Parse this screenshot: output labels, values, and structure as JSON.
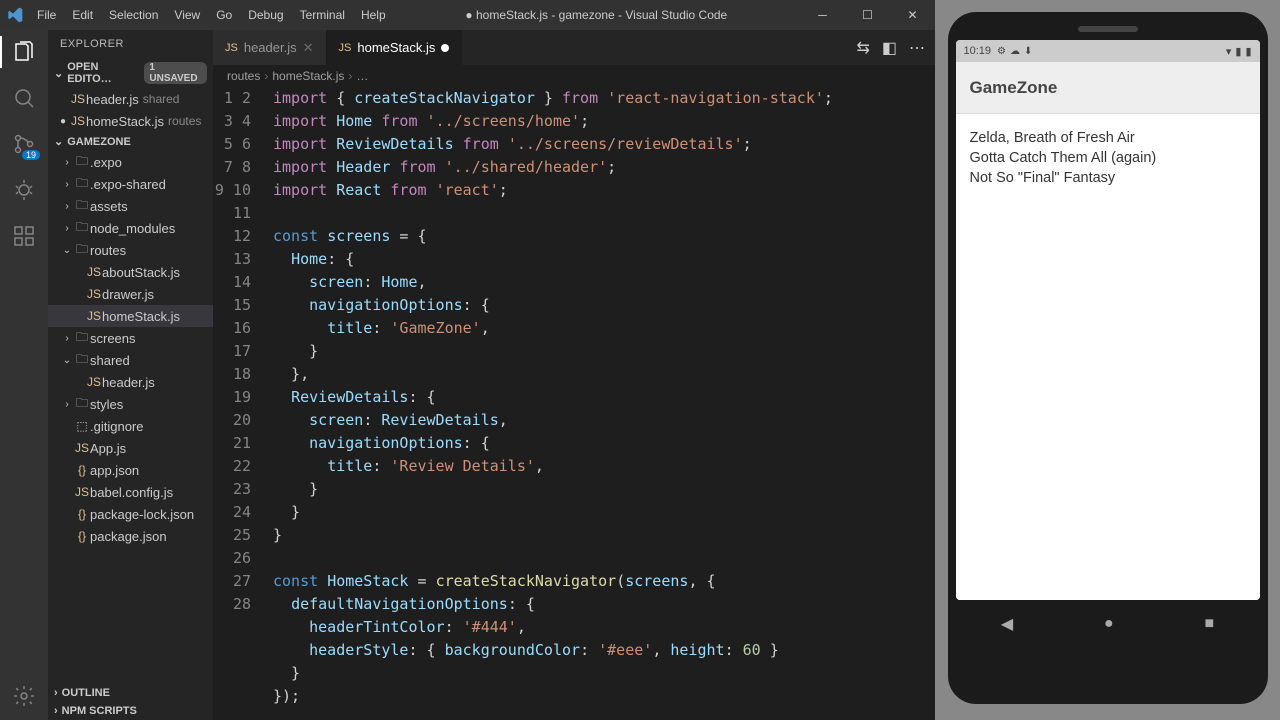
{
  "window": {
    "title": "● homeStack.js - gamezone - Visual Studio Code"
  },
  "menu": [
    "File",
    "Edit",
    "Selection",
    "View",
    "Go",
    "Debug",
    "Terminal",
    "Help"
  ],
  "activity": {
    "scm_badge": "19"
  },
  "explorer": {
    "title": "EXPLORER",
    "open_editors": "OPEN EDITO…",
    "unsaved": "1 UNSAVED",
    "open_items": [
      {
        "name": "header.js",
        "hint": "shared"
      },
      {
        "name": "homeStack.js",
        "hint": "routes",
        "dirty": true
      }
    ],
    "project": "GAMEZONE",
    "tree": [
      {
        "d": 1,
        "t": "folder",
        "tw": "›",
        "name": ".expo"
      },
      {
        "d": 1,
        "t": "folder",
        "tw": "›",
        "name": ".expo-shared"
      },
      {
        "d": 1,
        "t": "folder",
        "tw": "›",
        "name": "assets"
      },
      {
        "d": 1,
        "t": "folder",
        "tw": "›",
        "name": "node_modules"
      },
      {
        "d": 1,
        "t": "folder",
        "tw": "⌄",
        "name": "routes"
      },
      {
        "d": 2,
        "t": "js",
        "name": "aboutStack.js"
      },
      {
        "d": 2,
        "t": "js",
        "name": "drawer.js"
      },
      {
        "d": 2,
        "t": "js",
        "name": "homeStack.js",
        "sel": true
      },
      {
        "d": 1,
        "t": "folder",
        "tw": "›",
        "name": "screens"
      },
      {
        "d": 1,
        "t": "folder",
        "tw": "⌄",
        "name": "shared"
      },
      {
        "d": 2,
        "t": "js",
        "name": "header.js"
      },
      {
        "d": 1,
        "t": "folder",
        "tw": "›",
        "name": "styles"
      },
      {
        "d": 1,
        "t": "file",
        "name": ".gitignore"
      },
      {
        "d": 1,
        "t": "js",
        "name": "App.js"
      },
      {
        "d": 1,
        "t": "json",
        "name": "app.json"
      },
      {
        "d": 1,
        "t": "js",
        "name": "babel.config.js"
      },
      {
        "d": 1,
        "t": "json",
        "name": "package-lock.json"
      },
      {
        "d": 1,
        "t": "json",
        "name": "package.json"
      }
    ],
    "outline": "OUTLINE",
    "npm": "NPM SCRIPTS"
  },
  "tabs": [
    {
      "name": "header.js",
      "dirty": false
    },
    {
      "name": "homeStack.js",
      "dirty": true,
      "active": true
    }
  ],
  "breadcrumb": [
    "routes",
    "homeStack.js",
    "…"
  ],
  "code_lines": [
    [
      [
        "kw",
        "import"
      ],
      [
        "pn",
        " { "
      ],
      [
        "vr",
        "createStackNavigator"
      ],
      [
        "pn",
        " } "
      ],
      [
        "kw",
        "from"
      ],
      [
        "pn",
        " "
      ],
      [
        "st",
        "'react-navigation-stack'"
      ],
      [
        "pn",
        ";"
      ]
    ],
    [
      [
        "kw",
        "import"
      ],
      [
        "pn",
        " "
      ],
      [
        "vr",
        "Home"
      ],
      [
        "pn",
        " "
      ],
      [
        "kw",
        "from"
      ],
      [
        "pn",
        " "
      ],
      [
        "st",
        "'../screens/home'"
      ],
      [
        "pn",
        ";"
      ]
    ],
    [
      [
        "kw",
        "import"
      ],
      [
        "pn",
        " "
      ],
      [
        "vr",
        "ReviewDetails"
      ],
      [
        "pn",
        " "
      ],
      [
        "kw",
        "from"
      ],
      [
        "pn",
        " "
      ],
      [
        "st",
        "'../screens/reviewDetails'"
      ],
      [
        "pn",
        ";"
      ]
    ],
    [
      [
        "kw",
        "import"
      ],
      [
        "pn",
        " "
      ],
      [
        "vr",
        "Header"
      ],
      [
        "pn",
        " "
      ],
      [
        "kw",
        "from"
      ],
      [
        "pn",
        " "
      ],
      [
        "st",
        "'../shared/header'"
      ],
      [
        "pn",
        ";"
      ]
    ],
    [
      [
        "kw",
        "import"
      ],
      [
        "pn",
        " "
      ],
      [
        "vr",
        "React"
      ],
      [
        "pn",
        " "
      ],
      [
        "kw",
        "from"
      ],
      [
        "pn",
        " "
      ],
      [
        "st",
        "'react'"
      ],
      [
        "pn",
        ";"
      ]
    ],
    [],
    [
      [
        "cn",
        "const"
      ],
      [
        "pn",
        " "
      ],
      [
        "vr",
        "screens"
      ],
      [
        "pn",
        " = {"
      ]
    ],
    [
      [
        "pn",
        "  "
      ],
      [
        "vr",
        "Home"
      ],
      [
        "pn",
        ": {"
      ]
    ],
    [
      [
        "pn",
        "    "
      ],
      [
        "vr",
        "screen"
      ],
      [
        "pn",
        ": "
      ],
      [
        "vr",
        "Home"
      ],
      [
        "pn",
        ","
      ]
    ],
    [
      [
        "pn",
        "    "
      ],
      [
        "vr",
        "navigationOptions"
      ],
      [
        "pn",
        ": {"
      ]
    ],
    [
      [
        "pn",
        "      "
      ],
      [
        "vr",
        "title"
      ],
      [
        "pn",
        ": "
      ],
      [
        "st",
        "'GameZone'"
      ],
      [
        "pn",
        ","
      ]
    ],
    [
      [
        "pn",
        "    }"
      ]
    ],
    [
      [
        "pn",
        "  },"
      ]
    ],
    [
      [
        "pn",
        "  "
      ],
      [
        "vr",
        "ReviewDetails"
      ],
      [
        "pn",
        ": {"
      ]
    ],
    [
      [
        "pn",
        "    "
      ],
      [
        "vr",
        "screen"
      ],
      [
        "pn",
        ": "
      ],
      [
        "vr",
        "ReviewDetails"
      ],
      [
        "pn",
        ","
      ]
    ],
    [
      [
        "pn",
        "    "
      ],
      [
        "vr",
        "navigationOptions"
      ],
      [
        "pn",
        ": {"
      ]
    ],
    [
      [
        "pn",
        "      "
      ],
      [
        "vr",
        "title"
      ],
      [
        "pn",
        ": "
      ],
      [
        "st",
        "'Review Details'"
      ],
      [
        "pn",
        ","
      ]
    ],
    [
      [
        "pn",
        "    }"
      ]
    ],
    [
      [
        "pn",
        "  }"
      ]
    ],
    [
      [
        "pn",
        "}"
      ]
    ],
    [],
    [
      [
        "cn",
        "const"
      ],
      [
        "pn",
        " "
      ],
      [
        "vr",
        "HomeStack"
      ],
      [
        "pn",
        " = "
      ],
      [
        "fn",
        "createStackNavigator"
      ],
      [
        "pn",
        "("
      ],
      [
        "vr",
        "screens"
      ],
      [
        "pn",
        ", {"
      ]
    ],
    [
      [
        "pn",
        "  "
      ],
      [
        "vr",
        "defaultNavigationOptions"
      ],
      [
        "pn",
        ": {"
      ]
    ],
    [
      [
        "pn",
        "    "
      ],
      [
        "vr",
        "headerTintColor"
      ],
      [
        "pn",
        ": "
      ],
      [
        "st",
        "'#444'"
      ],
      [
        "pn",
        ","
      ]
    ],
    [
      [
        "pn",
        "    "
      ],
      [
        "vr",
        "headerStyle"
      ],
      [
        "pn",
        ": { "
      ],
      [
        "vr",
        "backgroundColor"
      ],
      [
        "pn",
        ": "
      ],
      [
        "st",
        "'#eee'"
      ],
      [
        "pn",
        ", "
      ],
      [
        "vr",
        "height"
      ],
      [
        "pn",
        ": "
      ],
      [
        "nm",
        "60"
      ],
      [
        "pn",
        " }"
      ]
    ],
    [
      [
        "pn",
        "  }"
      ]
    ],
    [
      [
        "pn",
        "});"
      ]
    ],
    []
  ],
  "phone": {
    "time": "10:19",
    "app_title": "GameZone",
    "items": [
      "Zelda, Breath of Fresh Air",
      "Gotta Catch Them All (again)",
      "Not So \"Final\" Fantasy"
    ]
  }
}
